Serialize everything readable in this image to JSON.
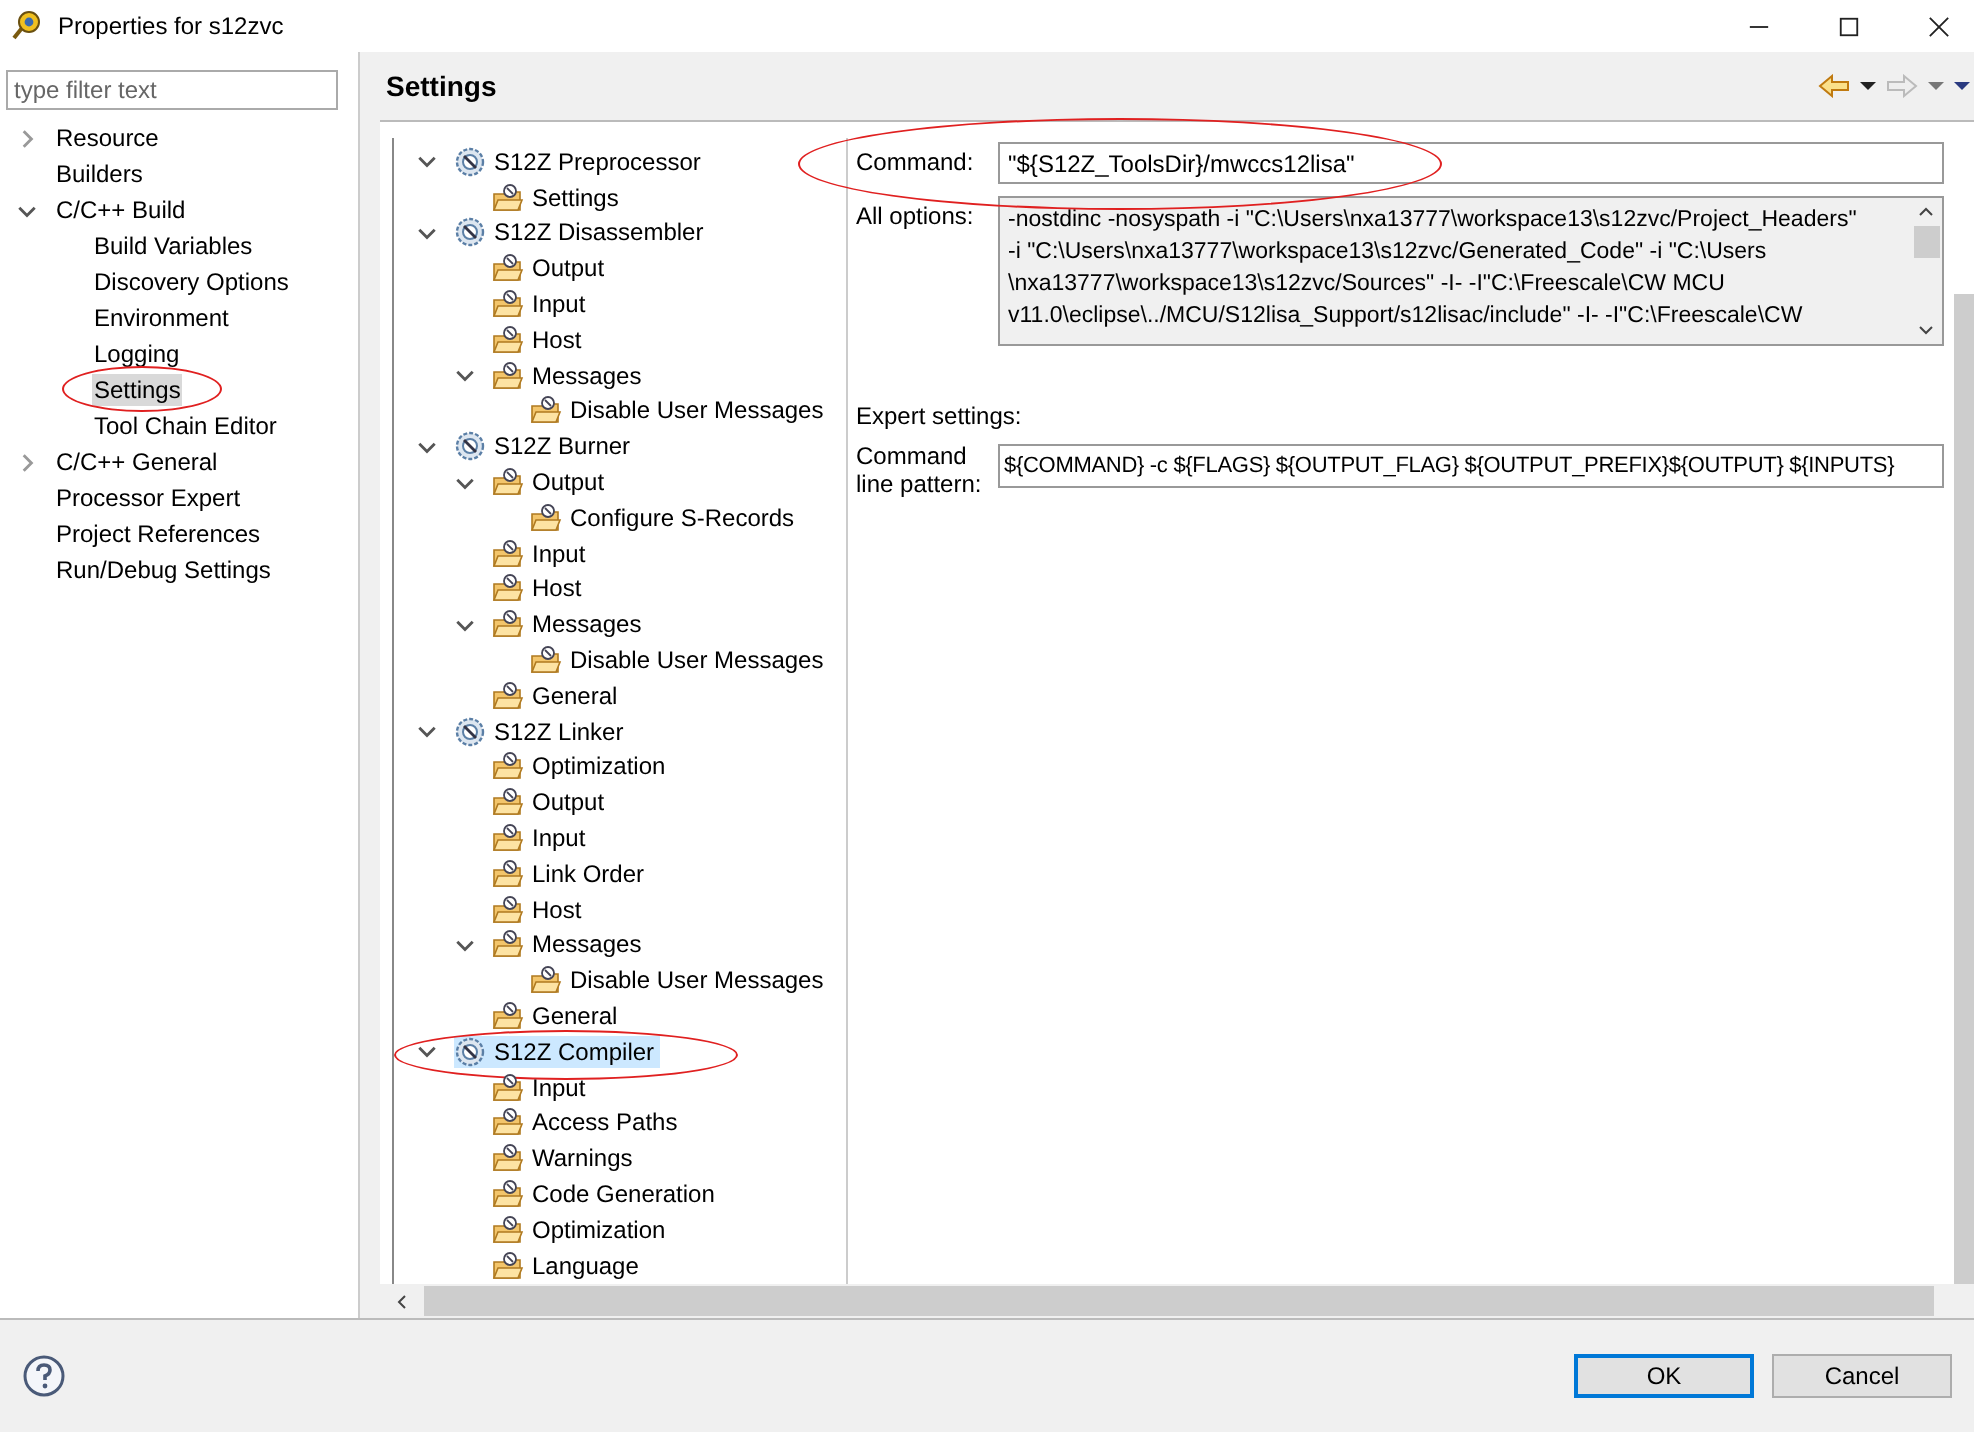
{
  "window": {
    "title": "Properties for s12zvc"
  },
  "filter": {
    "placeholder": "type filter text"
  },
  "sidebar": {
    "items": [
      {
        "label": "Resource",
        "expandable": true,
        "expanded": false,
        "selected": false,
        "annotated": false
      },
      {
        "label": "Builders",
        "expandable": false,
        "selected": false,
        "annotated": false
      },
      {
        "label": "C/C++ Build",
        "expandable": true,
        "expanded": true,
        "selected": false,
        "annotated": false,
        "children": [
          {
            "label": "Build Variables",
            "expandable": false,
            "selected": false,
            "annotated": false
          },
          {
            "label": "Discovery Options",
            "expandable": false,
            "selected": false,
            "annotated": false
          },
          {
            "label": "Environment",
            "expandable": false,
            "selected": false,
            "annotated": false
          },
          {
            "label": "Logging",
            "expandable": false,
            "selected": false,
            "annotated": false
          },
          {
            "label": "Settings",
            "expandable": false,
            "selected": true,
            "annotated": true
          },
          {
            "label": "Tool Chain Editor",
            "expandable": false,
            "selected": false,
            "annotated": false
          }
        ]
      },
      {
        "label": "C/C++ General",
        "expandable": true,
        "expanded": false,
        "selected": false,
        "annotated": false
      },
      {
        "label": "Processor Expert",
        "expandable": false,
        "selected": false,
        "annotated": false
      },
      {
        "label": "Project References",
        "expandable": false,
        "selected": false,
        "annotated": false
      },
      {
        "label": "Run/Debug Settings",
        "expandable": false,
        "selected": false,
        "annotated": false
      }
    ]
  },
  "page_title": "Settings",
  "tool_tree": [
    {
      "label": "S12Z Preprocessor",
      "kind": "tool",
      "expandable": true,
      "expanded": true,
      "selected": false,
      "annotated": false,
      "children": [
        {
          "label": "Settings",
          "kind": "category",
          "expandable": false,
          "selected": false,
          "annotated": false
        }
      ]
    },
    {
      "label": "S12Z Disassembler",
      "kind": "tool",
      "expandable": true,
      "expanded": true,
      "selected": false,
      "annotated": false,
      "children": [
        {
          "label": "Output",
          "kind": "category",
          "expandable": false,
          "selected": false,
          "annotated": false
        },
        {
          "label": "Input",
          "kind": "category",
          "expandable": false,
          "selected": false,
          "annotated": false
        },
        {
          "label": "Host",
          "kind": "category",
          "expandable": false,
          "selected": false,
          "annotated": false
        },
        {
          "label": "Messages",
          "kind": "category",
          "expandable": true,
          "expanded": true,
          "selected": false,
          "annotated": false,
          "children": [
            {
              "label": "Disable User Messages",
              "kind": "category",
              "expandable": false,
              "selected": false,
              "annotated": false
            }
          ]
        }
      ]
    },
    {
      "label": "S12Z Burner",
      "kind": "tool",
      "expandable": true,
      "expanded": true,
      "selected": false,
      "annotated": false,
      "children": [
        {
          "label": "Output",
          "kind": "category",
          "expandable": true,
          "expanded": true,
          "selected": false,
          "annotated": false,
          "children": [
            {
              "label": "Configure S-Records",
              "kind": "category",
              "expandable": false,
              "selected": false,
              "annotated": false
            }
          ]
        },
        {
          "label": "Input",
          "kind": "category",
          "expandable": false,
          "selected": false,
          "annotated": false
        },
        {
          "label": "Host",
          "kind": "category",
          "expandable": false,
          "selected": false,
          "annotated": false
        },
        {
          "label": "Messages",
          "kind": "category",
          "expandable": true,
          "expanded": true,
          "selected": false,
          "annotated": false,
          "children": [
            {
              "label": "Disable User Messages",
              "kind": "category",
              "expandable": false,
              "selected": false,
              "annotated": false
            }
          ]
        },
        {
          "label": "General",
          "kind": "category",
          "expandable": false,
          "selected": false,
          "annotated": false
        }
      ]
    },
    {
      "label": "S12Z Linker",
      "kind": "tool",
      "expandable": true,
      "expanded": true,
      "selected": false,
      "annotated": false,
      "children": [
        {
          "label": "Optimization",
          "kind": "category",
          "expandable": false,
          "selected": false,
          "annotated": false
        },
        {
          "label": "Output",
          "kind": "category",
          "expandable": false,
          "selected": false,
          "annotated": false
        },
        {
          "label": "Input",
          "kind": "category",
          "expandable": false,
          "selected": false,
          "annotated": false
        },
        {
          "label": "Link Order",
          "kind": "category",
          "expandable": false,
          "selected": false,
          "annotated": false
        },
        {
          "label": "Host",
          "kind": "category",
          "expandable": false,
          "selected": false,
          "annotated": false
        },
        {
          "label": "Messages",
          "kind": "category",
          "expandable": true,
          "expanded": true,
          "selected": false,
          "annotated": false,
          "children": [
            {
              "label": "Disable User Messages",
              "kind": "category",
              "expandable": false,
              "selected": false,
              "annotated": false
            }
          ]
        },
        {
          "label": "General",
          "kind": "category",
          "expandable": false,
          "selected": false,
          "annotated": false
        }
      ]
    },
    {
      "label": "S12Z Compiler",
      "kind": "tool",
      "expandable": true,
      "expanded": true,
      "selected": true,
      "annotated": true,
      "children": [
        {
          "label": "Input",
          "kind": "category",
          "expandable": false,
          "selected": false,
          "annotated": false
        },
        {
          "label": "Access Paths",
          "kind": "category",
          "expandable": false,
          "selected": false,
          "annotated": false
        },
        {
          "label": "Warnings",
          "kind": "category",
          "expandable": false,
          "selected": false,
          "annotated": false
        },
        {
          "label": "Code Generation",
          "kind": "category",
          "expandable": false,
          "selected": false,
          "annotated": false
        },
        {
          "label": "Optimization",
          "kind": "category",
          "expandable": false,
          "selected": false,
          "annotated": false
        },
        {
          "label": "Language",
          "kind": "category",
          "expandable": false,
          "selected": false,
          "annotated": false
        }
      ]
    }
  ],
  "command": {
    "label": "Command:",
    "value": "\"${S12Z_ToolsDir}/mwccs12lisa\"",
    "annotated": true
  },
  "all_options": {
    "label": "All options:",
    "lines": [
      "-nostdinc -nosyspath -i \"C:\\Users\\nxa13777\\workspace13\\s12zvc/Project_Headers\"",
      "-i \"C:\\Users\\nxa13777\\workspace13\\s12zvc/Generated_Code\" -i \"C:\\Users",
      "\\nxa13777\\workspace13\\s12zvc/Sources\" -I- -I\"C:\\Freescale\\CW MCU",
      "v11.0\\eclipse\\../MCU/S12lisa_Support/s12lisac/include\" -I- -I\"C:\\Freescale\\CW"
    ]
  },
  "expert_settings": {
    "heading": "Expert settings:",
    "pattern_label": "Command line pattern:",
    "pattern": "${COMMAND} -c ${FLAGS} ${OUTPUT_FLAG} ${OUTPUT_PREFIX}${OUTPUT} ${INPUTS}"
  },
  "buttons": [
    {
      "label": "OK",
      "default": true
    },
    {
      "label": "Cancel",
      "default": false
    }
  ]
}
